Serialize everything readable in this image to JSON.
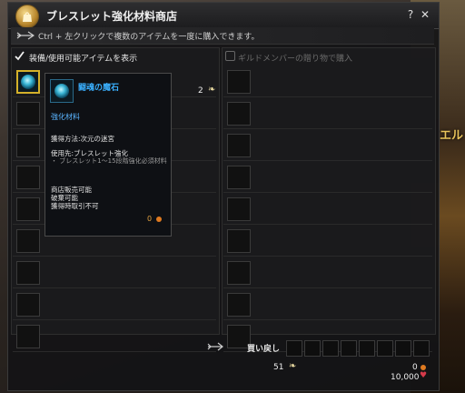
{
  "window": {
    "title": "ブレスレット強化材料商店",
    "help_label": "?",
    "close_label": "✕"
  },
  "hint": {
    "text": "Ctrl + 左クリックで複数のアイテムを一度に購入できます。"
  },
  "left_panel": {
    "filter_label": "装備/使用可能アイテムを表示",
    "filter_checked": true,
    "rows": [
      {
        "selected": true,
        "has_item": true,
        "quantity": "2"
      },
      {
        "selected": false,
        "has_item": false
      },
      {
        "selected": false,
        "has_item": false
      },
      {
        "selected": false,
        "has_item": false
      },
      {
        "selected": false,
        "has_item": false
      },
      {
        "selected": false,
        "has_item": false
      },
      {
        "selected": false,
        "has_item": false
      },
      {
        "selected": false,
        "has_item": false
      },
      {
        "selected": false,
        "has_item": false
      }
    ]
  },
  "right_panel": {
    "guild_label": "ギルドメンバーの贈り物で購入",
    "rows": 9
  },
  "tooltip": {
    "name": "闘魂の魔石",
    "type": "強化材料",
    "obtain": "獲得方法:次元の迷宮",
    "usage_title": "使用先:ブレスレット強化",
    "usage_detail": "・ ブレスレット1〜15段階強化必須材料",
    "flag_sell": "商店販売可能",
    "flag_dismantle": "破棄可能",
    "flag_trade": "獲得時取引不可",
    "price": "0"
  },
  "footer": {
    "buyback_label": "買い戻し",
    "feather_count": "51",
    "coin_count": "0",
    "heart_count": "10,000",
    "buyback_slots": 8
  },
  "background": {
    "side_text": "エル"
  },
  "colors": {
    "accent_gold": "#d4b02a",
    "item_name_blue": "#3ab0ff",
    "coin_orange": "#e07a20"
  }
}
